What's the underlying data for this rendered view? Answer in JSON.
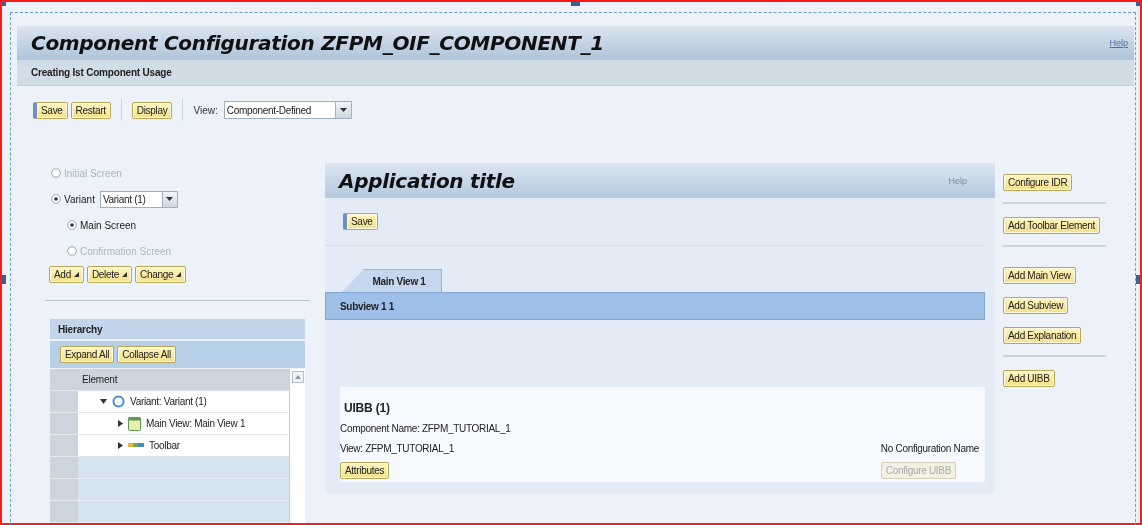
{
  "header": {
    "title": "Component Configuration ZFPM_OIF_COMPONENT_1",
    "help": "Help",
    "subtitle": "Creating Ist Component Usage"
  },
  "toolbar": {
    "groups": [
      [
        {
          "label": "Save",
          "kind": "emphasized"
        },
        {
          "label": "Restart",
          "kind": "standard"
        }
      ],
      [
        {
          "label": "Display",
          "kind": "standard"
        }
      ]
    ],
    "view_label": "View:",
    "view_value": "Component-Defined"
  },
  "screens": [
    {
      "label": "Initial Screen",
      "selected": false,
      "disabled": true
    },
    {
      "label": "Variant",
      "selected": true,
      "disabled": false,
      "value": "Variant (1)",
      "children": [
        {
          "label": "Main Screen",
          "selected": true,
          "disabled": false
        },
        {
          "label": "Confirmation Screen",
          "selected": false,
          "disabled": true
        }
      ]
    }
  ],
  "screen_actions": [
    {
      "label": "Add",
      "kind": "menu"
    },
    {
      "label": "Delete",
      "kind": "menu"
    },
    {
      "label": "Change",
      "kind": "menu"
    }
  ],
  "hierarchy": {
    "title": "Hierarchy",
    "buttons": [
      "Expand All",
      "Collapse All"
    ],
    "column": "Element",
    "tree": [
      {
        "label": "Variant: Variant (1)",
        "kind": "variant",
        "expanded": true,
        "children": [
          {
            "label": "Main View: Main View 1",
            "kind": "view",
            "expanded": false
          },
          {
            "label": "Toolbar",
            "kind": "toolbar",
            "expanded": false
          }
        ]
      }
    ]
  },
  "preview": {
    "title": "Application title",
    "help": "Help",
    "buttons": [
      {
        "label": "Save",
        "kind": "emphasized"
      }
    ],
    "tabs": [
      {
        "label": "Main View 1",
        "selected": true
      }
    ],
    "subviews": [
      {
        "label": "Subview 1 1",
        "selected": true
      }
    ],
    "uibb": {
      "title": "UIBB (1)",
      "component": "Component Name: ZFPM_TUTORIAL_1",
      "view": "View: ZFPM_TUTORIAL_1",
      "configuration": "No Configuration Name",
      "buttons": [
        {
          "label": "Attributes",
          "disabled": false
        },
        {
          "label": "Configure UIBB",
          "disabled": true
        }
      ]
    }
  },
  "side_actions": [
    [
      "Configure IDR"
    ],
    [
      "Add Toolbar Element"
    ],
    [
      "Add Main View",
      "Add Subview",
      "Add Explanation"
    ],
    [
      "Add UIBB"
    ]
  ]
}
